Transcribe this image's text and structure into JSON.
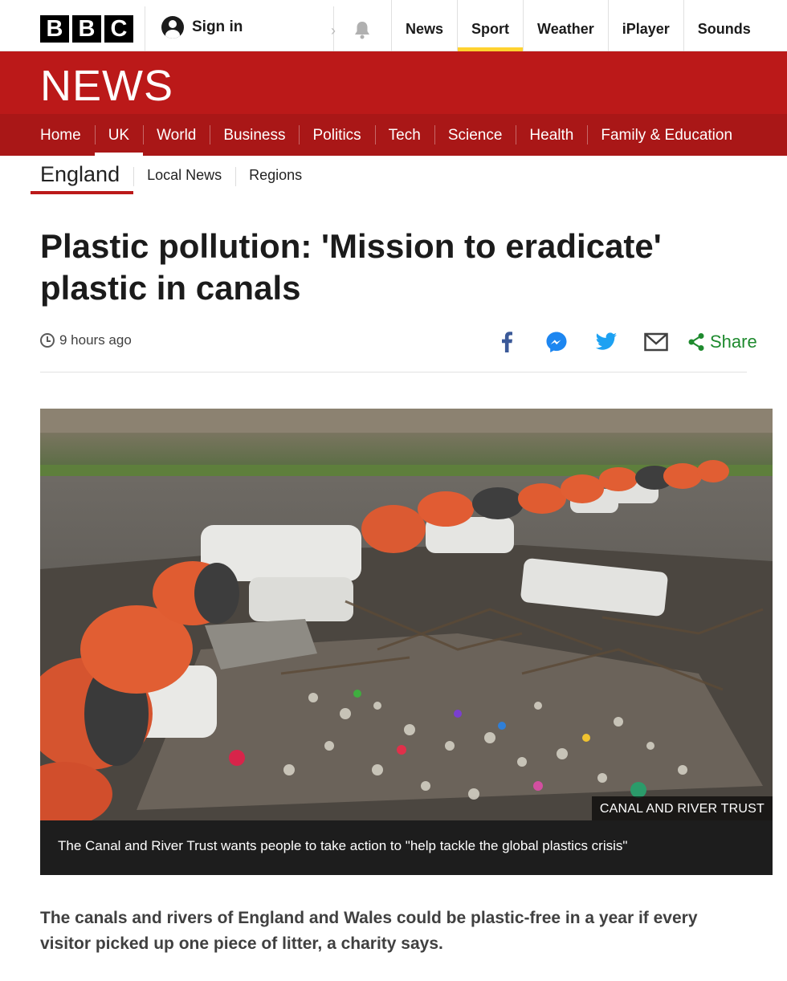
{
  "brand": {
    "letters": [
      "B",
      "B",
      "C"
    ]
  },
  "account": {
    "sign_in_label": "Sign in"
  },
  "top_nav": [
    {
      "label": "News",
      "active": false
    },
    {
      "label": "Sport",
      "active": true
    },
    {
      "label": "Weather",
      "active": false
    },
    {
      "label": "iPlayer",
      "active": false
    },
    {
      "label": "Sounds",
      "active": false
    }
  ],
  "news_banner": {
    "wordmark": "NEWS"
  },
  "section_nav": [
    {
      "label": "Home"
    },
    {
      "label": "UK"
    },
    {
      "label": "World"
    },
    {
      "label": "Business"
    },
    {
      "label": "Politics"
    },
    {
      "label": "Tech"
    },
    {
      "label": "Science"
    },
    {
      "label": "Health"
    },
    {
      "label": "Family & Education"
    }
  ],
  "sub_nav": [
    {
      "label": "England"
    },
    {
      "label": "Local News"
    },
    {
      "label": "Regions"
    }
  ],
  "article": {
    "headline": "Plastic pollution: 'Mission to eradicate' plastic in canals",
    "timestamp": "9 hours ago",
    "share_label": "Share",
    "image_credit": "CANAL AND RIVER TRUST",
    "caption": "The Canal and River Trust wants people to take action to \"help tackle the global plastics crisis\"",
    "lead": "The canals and rivers of England and Wales could be plastic-free in a year if every visitor picked up one piece of litter, a charity says."
  },
  "colors": {
    "news_red": "#bb1919",
    "section_red": "#a91717",
    "sport_accent": "#ffd230",
    "share_green": "#1e8a2e",
    "facebook_blue": "#3b5998",
    "twitter_blue": "#1da1f2"
  },
  "icons": [
    "bbc-logo",
    "user-icon",
    "chevron-right-icon",
    "bell-icon",
    "clock-icon",
    "facebook-icon",
    "messenger-icon",
    "twitter-icon",
    "email-icon",
    "share-icon"
  ]
}
